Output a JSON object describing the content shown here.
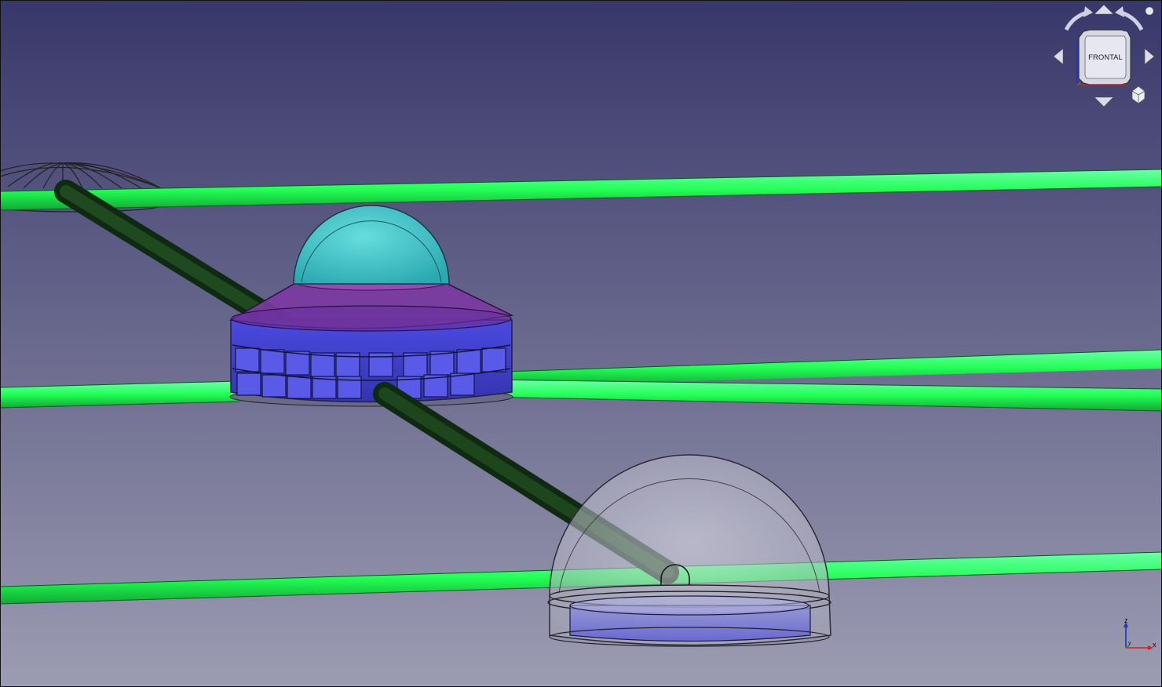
{
  "view": {
    "background_top": "#38376a",
    "background_bottom": "#9a9ab0",
    "pipe_color": "#22ff66",
    "connector_color": "#1a3a1a"
  },
  "navcube": {
    "face_label": "FRONTAL",
    "icons": [
      "rotate-left-icon",
      "rotate-right-icon",
      "arrow-up-icon",
      "arrow-down-icon",
      "arrow-left-icon",
      "arrow-right-icon",
      "view-menu-icon",
      "home-dot-icon"
    ]
  },
  "axis": {
    "x_label": "x",
    "y_label": "y",
    "z_label": "z",
    "x_color": "#d02020",
    "y_color": "#20a020",
    "z_color": "#2030c0"
  }
}
